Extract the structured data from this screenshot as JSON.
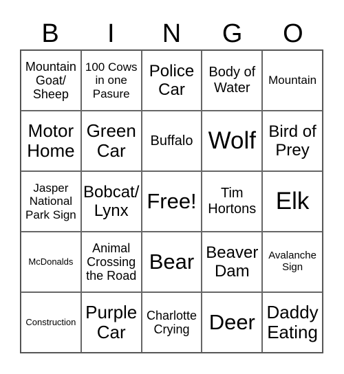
{
  "header": [
    "B",
    "I",
    "N",
    "G",
    "O"
  ],
  "cells": [
    "Mountain Goat/ Sheep",
    "100 Cows in one Pasure",
    "Police Car",
    "Body of Water",
    "Mountain",
    "Motor Home",
    "Green Car",
    "Buffalo",
    "Wolf",
    "Bird of Prey",
    "Jasper National Park Sign",
    "Bobcat/ Lynx",
    "Free!",
    "Tim Hortons",
    "Elk",
    "McDonalds",
    "Animal Crossing the Road",
    "Bear",
    "Beaver Dam",
    "Avalanche Sign",
    "Construction",
    "Purple Car",
    "Charlotte Crying",
    "Deer",
    "Daddy Eating"
  ]
}
